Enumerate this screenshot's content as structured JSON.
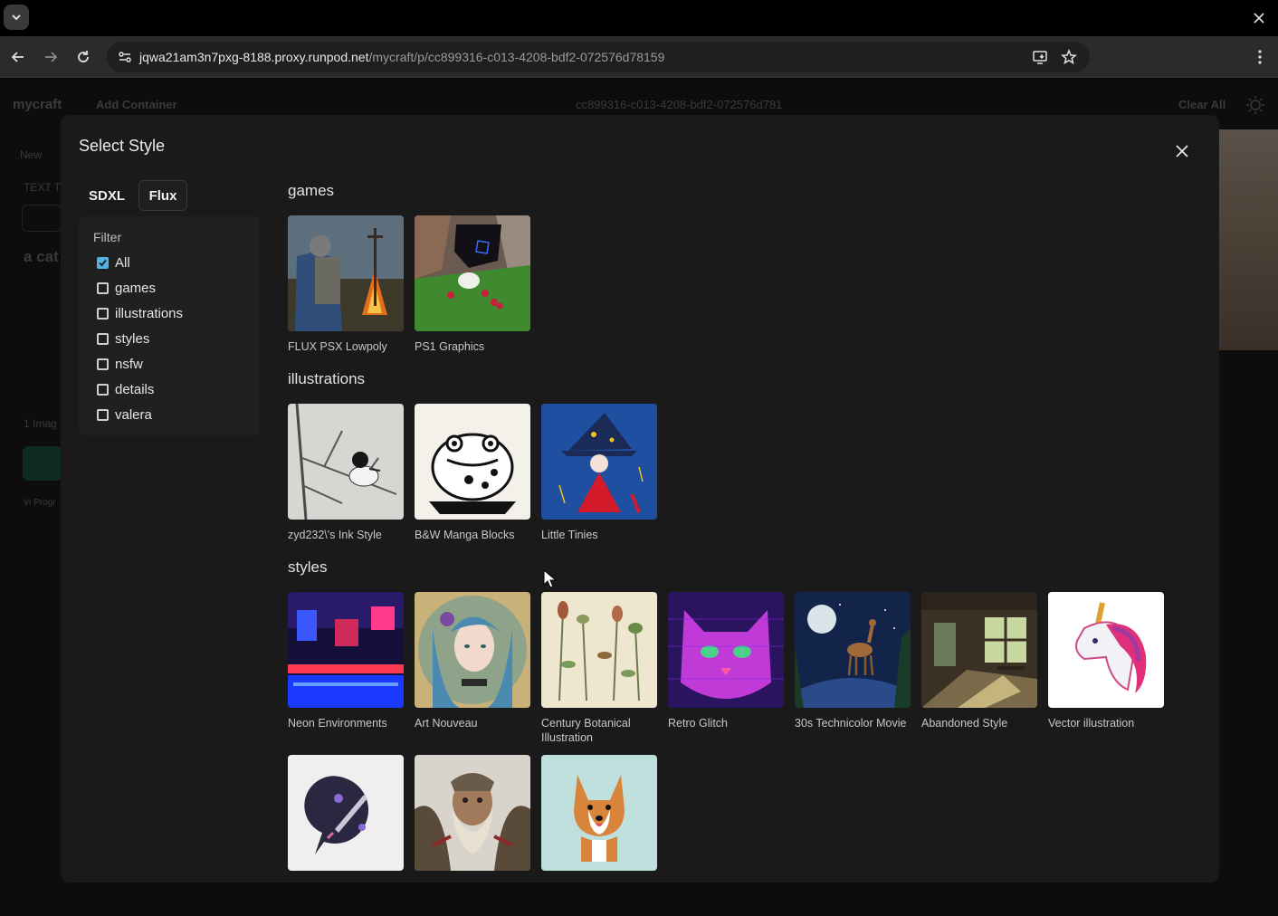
{
  "browser": {
    "url_host": "jqwa21am3n7pxg-8188.proxy.runpod.net",
    "url_path": "/mycraft/p/cc899316-c013-4208-bdf2-072576d78159"
  },
  "app": {
    "brand": "mycraft",
    "add_container": "Add Container",
    "header_id": "cc899316-c013-4208-bdf2-072576d781",
    "clear_all": "Clear All",
    "side_new": "New",
    "side_text": "TEXT T",
    "side_prompt": "a cat",
    "side_images": "1 Imag",
    "side_footer": "\\n Progr"
  },
  "modal": {
    "title": "Select Style",
    "tabs": [
      "SDXL",
      "Flux"
    ],
    "filter": {
      "title": "Filter",
      "items": [
        {
          "label": "All",
          "checked": true
        },
        {
          "label": "games",
          "checked": false
        },
        {
          "label": "illustrations",
          "checked": false
        },
        {
          "label": "styles",
          "checked": false
        },
        {
          "label": "nsfw",
          "checked": false
        },
        {
          "label": "details",
          "checked": false
        },
        {
          "label": "valera",
          "checked": false
        }
      ]
    },
    "sections": {
      "games": {
        "title": "games",
        "items": [
          "FLUX PSX Lowpoly",
          "PS1 Graphics"
        ]
      },
      "illustrations": {
        "title": "illustrations",
        "items": [
          "zyd232\\'s Ink Style",
          "B&W Manga Blocks",
          "Little Tinies"
        ]
      },
      "styles": {
        "title": "styles",
        "items": [
          "Neon Environments",
          "Art Nouveau",
          "Century Botanical Illustration",
          "Retro Glitch",
          "30s Technicolor Movie",
          "Abandoned Style",
          "Vector illustration",
          "",
          "",
          ""
        ]
      }
    }
  }
}
